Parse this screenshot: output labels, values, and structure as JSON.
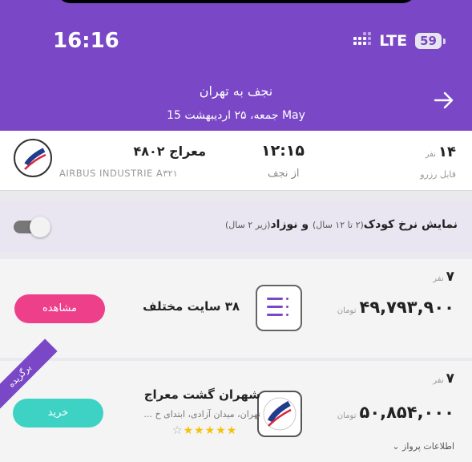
{
  "status_bar": {
    "time": "16:16",
    "network": "LTE",
    "battery": "59"
  },
  "header": {
    "route": "نجف به تهران",
    "date": "جمعه، ۲۵ اردیبهشت 15 May"
  },
  "flight": {
    "airline": "معراج ۴۸۰۲",
    "aircraft": "AIRBUS INDUSTRIE A۳۲۱",
    "departure_time": "۱۲:۱۵",
    "departure_from": "از نجف",
    "seats": "۱۴",
    "seats_unit": "نفر",
    "reservable": "قابل رزرو"
  },
  "toggle": {
    "label_bold": "نمایش نرخ کودک",
    "label_child_note": "(۲ تا ۱۲ سال)",
    "label_and": " و ",
    "label_infant": "نوزاد",
    "label_infant_note": "(زیر ۲ سال)"
  },
  "offers": [
    {
      "seats": "۷",
      "seats_unit": "نفر",
      "title": "۳۸ سایت مختلف",
      "price": "۴۹,۷۹۳,۹۰۰",
      "currency": "تومان",
      "button": "مشاهده"
    },
    {
      "ribbon": "برگزیده",
      "seats": "۷",
      "seats_unit": "نفر",
      "agency": "شهران گشت معراج",
      "address": "تهران، میدان آزادی، ابتدای خ ...",
      "price": "۵۰,۸۵۴,۰۰۰",
      "currency": "تومان",
      "button": "خرید",
      "flight_info": "اطلاعات پرواز"
    }
  ],
  "colors": {
    "brand": "#7a48c6",
    "pink": "#ee3f8a",
    "teal": "#3ed2c4",
    "star": "#f4c20d"
  }
}
